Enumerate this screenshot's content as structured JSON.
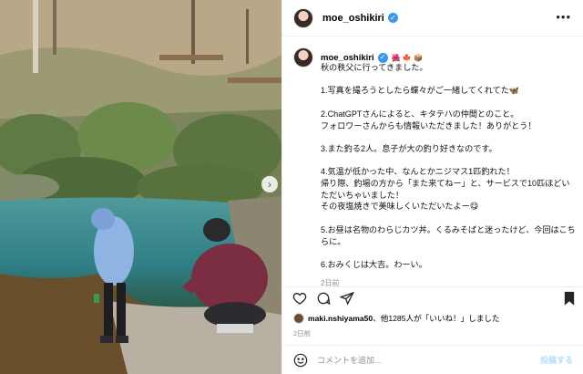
{
  "post": {
    "username": "moe_oshikiri",
    "verified": true,
    "more_icon": "more-options-icon",
    "caption": {
      "username": "moe_oshikiri",
      "emojis": "🌺 🍁 📦",
      "text": "秋の秩父に行ってきました。\n\n1.写真を撮ろうとしたら蝶々がご一緒してくれてた🦋\n\n2.ChatGPTさんによると、キタテハの仲間とのこと。\nフォロワーさんからも情報いただきました！ありがとう！\n\n3.また釣る2人。息子が大の釣り好きなのです。\n\n4.気温が低かった中、なんとかニジマス1匹釣れた！\n帰り際、釣場の方から「また来てねー」と、サービスで10匹ほどいただいちゃいました！\nその夜塩焼きで美味しくいただいたよー😋\n\n5.お昼は名物のわらじカツ丼。くるみそばと迷ったけど、今回はこちらに。\n\n6.おみくじは大吉。わーい。",
      "time": "2日前"
    },
    "actions": {
      "like_icon": "heart-icon",
      "comment_icon": "comment-icon",
      "share_icon": "share-icon",
      "save_icon": "bookmark-icon"
    },
    "likes": {
      "first_liker": "maki.nshiyama50",
      "text": "、他1285人が「いいね！」しました"
    },
    "date": "2日前",
    "comment": {
      "emoji_icon": "emoji-icon",
      "placeholder": "コメントを追加...",
      "post_label": "投稿する"
    },
    "photo": {
      "description_icon": "photo",
      "next_icon": "chevron-right-icon"
    },
    "colors": {
      "accent": "#0095f6",
      "post_button": "#b2dffc",
      "muted": "#8e8e8e",
      "border": "#efefef"
    }
  }
}
